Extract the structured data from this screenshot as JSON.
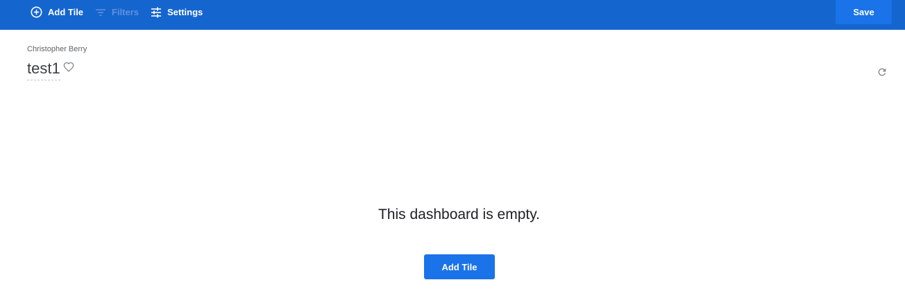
{
  "toolbar": {
    "add_tile_label": "Add Tile",
    "filters_label": "Filters",
    "settings_label": "Settings",
    "save_label": "Save",
    "background_color": "#1565cf",
    "disabled_color": "#5f92dc"
  },
  "dashboard": {
    "author": "Christopher Berry",
    "title": "test1",
    "favorite_icon": "heart-outline-icon",
    "refresh_icon": "refresh-icon"
  },
  "empty_state": {
    "message": "This dashboard is empty.",
    "add_tile_label": "Add Tile"
  },
  "colors": {
    "primary_button": "#1a73e8"
  }
}
